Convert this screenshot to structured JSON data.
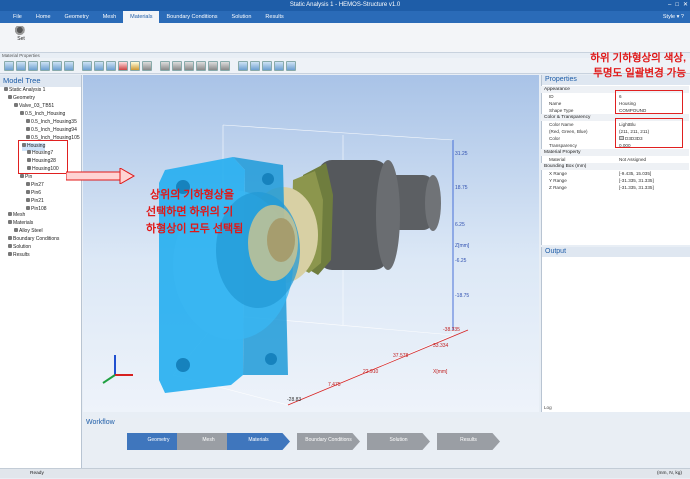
{
  "window": {
    "title": "Static Analysis 1 - HEMOS-Structure v1.0"
  },
  "menu": {
    "items": [
      "File",
      "Home",
      "Geometry",
      "Mesh",
      "Materials",
      "Boundary Conditions",
      "Solution",
      "Results"
    ],
    "active": "Materials",
    "style_label": "Style"
  },
  "ribbon": {
    "set_label": "Set",
    "group_label": "Material Properties"
  },
  "model_tree": {
    "title": "Model Tree",
    "items": [
      "Static Analysis 1",
      "Geometry",
      "Valve_03_TB51",
      "0.5_Inch_Housing",
      "0.5_Inch_Housing35",
      "0.5_Inch_Housing94",
      "0.5_Inch_Housing105",
      "Housing",
      "Housing7",
      "Housing28",
      "Housing100",
      "Pin",
      "Pin27",
      "Pin6",
      "Pin21",
      "Pin108",
      "Mesh",
      "Materials",
      "Alloy Steel",
      "Boundary Conditions",
      "Solution",
      "Results"
    ]
  },
  "viewport": {
    "axis_labels_right": [
      "31.25",
      "18.75",
      "6.25",
      "Z[mm]",
      "-6.25",
      "-18.75"
    ],
    "axis_labels_bottom": [
      "-38.335",
      "33.334",
      "37.578",
      "22.910",
      "7.475",
      "X[mm]"
    ],
    "axis_label_left_bottom": "-28.83"
  },
  "properties": {
    "title": "Properties",
    "sections": [
      {
        "name": "Appearance",
        "rows": [
          [
            "ID",
            "6"
          ],
          [
            "Name",
            "Housing"
          ],
          [
            "Shape Type",
            "COMPOUND"
          ]
        ]
      },
      {
        "name": "Color & Transparency",
        "rows": [
          [
            "Color Name",
            "LightBlu"
          ],
          [
            "(Red, Green, Blue)",
            "(211, 211, 211)"
          ],
          [
            "Color",
            "D3D3D3"
          ],
          [
            "Transparency",
            "0.000"
          ]
        ]
      },
      {
        "name": "Material Property",
        "rows": [
          [
            "Material",
            "Not Assigned"
          ]
        ]
      },
      {
        "name": "Bounding Box (mm)",
        "rows": [
          [
            "X Range",
            "[-9.435, 15.035]"
          ],
          [
            "Y Range",
            "[-31.335, 31.335]"
          ],
          [
            "Z Range",
            "[-31.335, 31.335]"
          ]
        ]
      }
    ]
  },
  "output": {
    "title": "Output",
    "log_tab": "Log"
  },
  "workflow": {
    "title": "Workflow",
    "steps": [
      {
        "label": "Geometry",
        "active": true
      },
      {
        "label": "Mesh",
        "active": false
      },
      {
        "label": "Materials",
        "active": true
      },
      {
        "label": "Boundary Conditions",
        "active": false
      },
      {
        "label": "Solution",
        "active": false
      },
      {
        "label": "Results",
        "active": false
      }
    ]
  },
  "status": {
    "left": "Ready",
    "right": "(mm, N, kg)"
  },
  "annotations": {
    "top_right_line1": "하위 기하형상의 색상,",
    "top_right_line2": "투명도 일괄변경 가능",
    "center_line1": "상위의 기하형상을",
    "center_line2": "선택하면 하위의 기",
    "center_line3": "하형상이 모두 선택됨"
  },
  "colors": {
    "accent": "#1e5da8",
    "annotation": "#e01818",
    "part_blue": "#2aa7f0"
  }
}
